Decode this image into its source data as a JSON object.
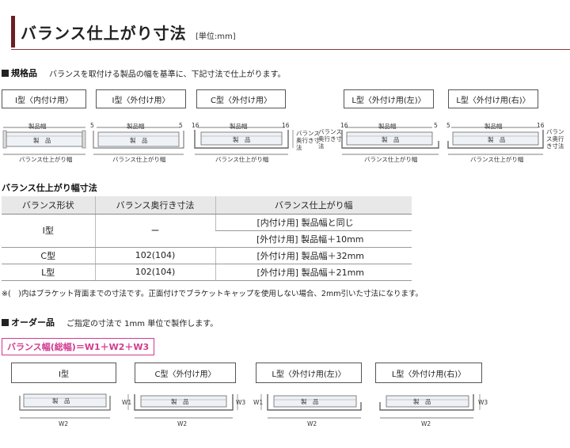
{
  "header": {
    "title": "バランス仕上がり寸法",
    "unit": "[単位:mm]"
  },
  "spec": {
    "heading": "規格品",
    "description": "バランスを取付ける製品の幅を基準に、下記寸法で仕上がります。",
    "types": [
      "I型〈内付け用〉",
      "I型〈外付け用〉",
      "C型〈外付け用〉",
      "L型〈外付け用(左)〉",
      "L型〈外付け用(右)〉"
    ],
    "diagram": {
      "product_width": "製品幅",
      "product": "製　品",
      "finish_width": "バランス仕上がり幅",
      "depth_label": "バランス奥行き寸法",
      "dim_5": "5",
      "dim_16": "16"
    }
  },
  "table": {
    "heading": "バランス仕上がり幅寸法",
    "headers": [
      "バランス形状",
      "バランス奥行き寸法",
      "バランス仕上がり幅"
    ],
    "rows": [
      {
        "shape": "I型",
        "depth": "ー",
        "width_a": "[内付け用] 製品幅と同じ",
        "width_b": "[外付け用] 製品幅＋10mm"
      },
      {
        "shape": "C型",
        "depth": "102(104)",
        "width": "[外付け用] 製品幅＋32mm"
      },
      {
        "shape": "L型",
        "depth": "102(104)",
        "width": "[外付け用] 製品幅＋21mm"
      }
    ],
    "note": "※(　)内はブラケット背面までの寸法です。正面付けでブラケットキャップを使用しない場合、2mm引いた寸法になります。"
  },
  "order": {
    "heading": "オーダー品",
    "description": "ご指定の寸法で 1mm 単位で製作します。",
    "formula": "バランス幅(総幅)＝W1＋W2＋W3",
    "types": [
      "I型",
      "C型〈外付け用〉",
      "L型〈外付け用(左)〉",
      "L型〈外付け用(右)〉"
    ],
    "diagram": {
      "product": "製　品",
      "w1": "W1",
      "w2": "W2",
      "w3": "W3"
    }
  }
}
